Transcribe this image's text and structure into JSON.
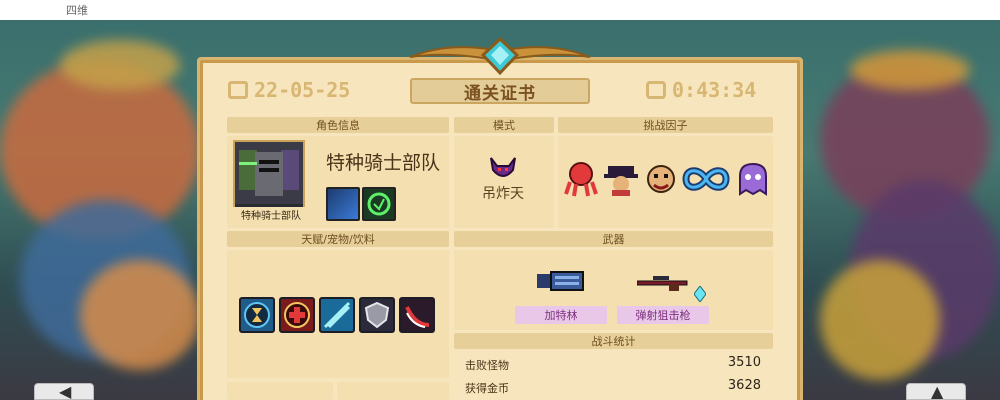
{
  "status_bar": {
    "text": "四维"
  },
  "certificate": {
    "title": "通关证书",
    "date": "22-05-25",
    "time": "0:43:34"
  },
  "sections": {
    "character_info": "角色信息",
    "mode": "模式",
    "challenge_factors": "挑战因子",
    "talents_pets_drinks": "天赋/宠物/饮料",
    "weapons": "武器",
    "battle_stats": "战斗统计"
  },
  "character": {
    "name": "特种骑士部队",
    "portrait_caption": "特种骑士部队",
    "skills": [
      "skill-blue-icon",
      "skill-green-shield-icon"
    ]
  },
  "mode": {
    "label": "吊炸天",
    "icon": "demon-helmet-icon"
  },
  "challenge_factors": [
    "red-octopus-icon",
    "hat-figure-icon",
    "goblin-face-icon",
    "infinity-icon",
    "purple-ghost-icon"
  ],
  "talents": [
    "hourglass-icon",
    "heal-cross-icon",
    "blade-icon",
    "shield-icon",
    "claw-slash-icon"
  ],
  "weapons": [
    {
      "name": "加特林",
      "icon": "gatling-gun-icon"
    },
    {
      "name": "弹射狙击枪",
      "icon": "sniper-rifle-icon"
    }
  ],
  "stats": [
    {
      "label": "击败怪物",
      "value": "3510"
    },
    {
      "label": "获得金币",
      "value": "3628"
    }
  ],
  "colors": {
    "panel": "#f7e6bd",
    "header": "#e7cf99",
    "accent_gold": "#d8b673",
    "weapon_tag": "#e8c7e8"
  }
}
